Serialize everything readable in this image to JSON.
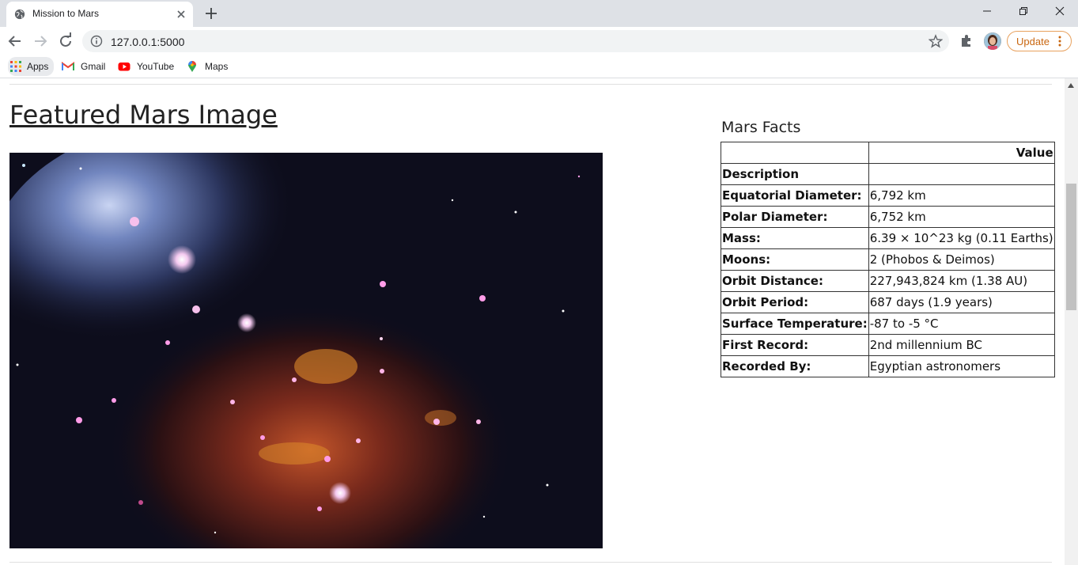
{
  "browser": {
    "tab_title": "Mission to Mars",
    "url": "127.0.0.1:5000",
    "update_label": "Update",
    "bookmarks": [
      {
        "label": "Apps",
        "icon": "apps-grid-icon"
      },
      {
        "label": "Gmail",
        "icon": "gmail-icon"
      },
      {
        "label": "YouTube",
        "icon": "youtube-icon"
      },
      {
        "label": "Maps",
        "icon": "maps-pin-icon"
      }
    ]
  },
  "page": {
    "featured_title": "Featured Mars Image",
    "facts_title": "Mars Facts",
    "table": {
      "header": "Value",
      "rows": [
        {
          "key": "Description",
          "value": ""
        },
        {
          "key": "Equatorial Diameter:",
          "value": "6,792 km"
        },
        {
          "key": "Polar Diameter:",
          "value": "6,752 km"
        },
        {
          "key": "Mass:",
          "value": "6.39 × 10^23 kg (0.11 Earths)"
        },
        {
          "key": "Moons:",
          "value": "2 (Phobos & Deimos)"
        },
        {
          "key": "Orbit Distance:",
          "value": "227,943,824 km (1.38 AU)"
        },
        {
          "key": "Orbit Period:",
          "value": "687 days (1.9 years)"
        },
        {
          "key": "Surface Temperature:",
          "value": "-87 to -5 °C"
        },
        {
          "key": "First Record:",
          "value": "2nd millennium BC"
        },
        {
          "key": "Recorded By:",
          "value": "Egyptian astronomers"
        }
      ]
    }
  },
  "colors": {
    "tabstrip": "#dee1e6",
    "update_accent": "#c9660f",
    "youtube_red": "#ff0000"
  }
}
